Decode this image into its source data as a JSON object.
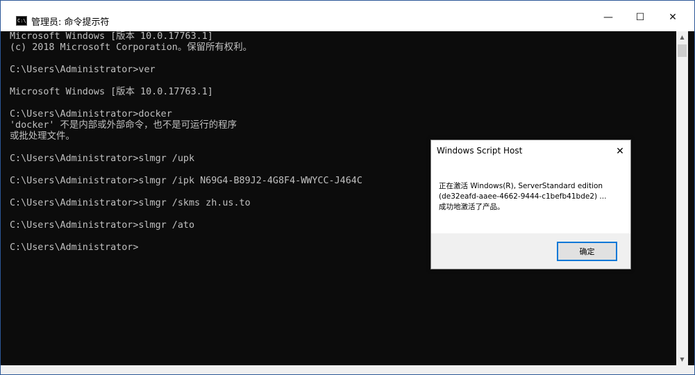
{
  "window": {
    "title": "管理员: 命令提示符",
    "icon_text": "C:\\",
    "controls": {
      "minimize": "—",
      "maximize": "☐",
      "close": "✕"
    }
  },
  "console": {
    "lines": [
      "Microsoft Windows [版本 10.0.17763.1]",
      "(c) 2018 Microsoft Corporation。保留所有权利。",
      "",
      "C:\\Users\\Administrator>ver",
      "",
      "Microsoft Windows [版本 10.0.17763.1]",
      "",
      "C:\\Users\\Administrator>docker",
      "'docker' 不是内部或外部命令，也不是可运行的程序",
      "或批处理文件。",
      "",
      "C:\\Users\\Administrator>slmgr /upk",
      "",
      "C:\\Users\\Administrator>slmgr /ipk N69G4-B89J2-4G8F4-WWYCC-J464C",
      "",
      "C:\\Users\\Administrator>slmgr /skms zh.us.to",
      "",
      "C:\\Users\\Administrator>slmgr /ato",
      "",
      "C:\\Users\\Administrator>"
    ]
  },
  "scrollbar": {
    "up": "▲",
    "down": "▼"
  },
  "dialog": {
    "title": "Windows Script Host",
    "close": "✕",
    "message_lines": [
      "正在激活 Windows(R), ServerStandard edition",
      "(de32eafd-aaee-4662-9444-c1befb41bde2) ...",
      "成功地激活了产品。"
    ],
    "ok_label": "确定"
  }
}
